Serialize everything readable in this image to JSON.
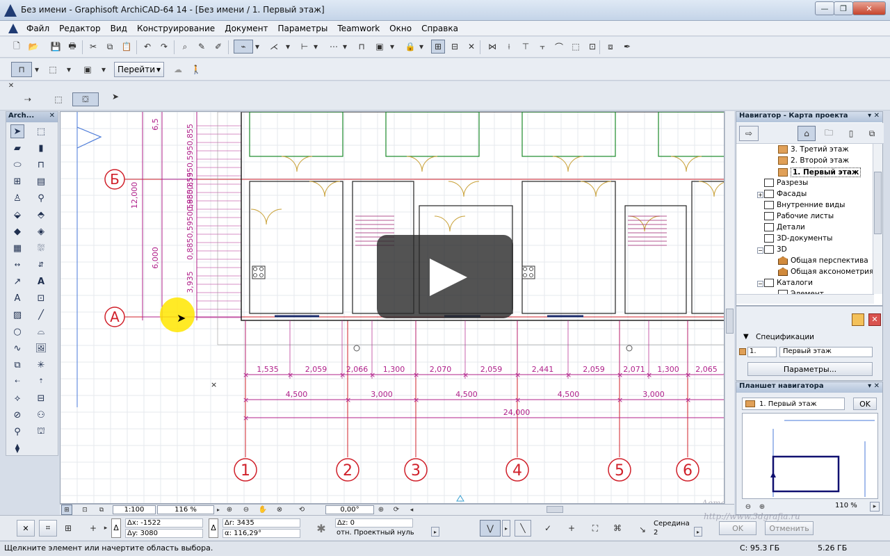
{
  "window": {
    "title": "Без имени - Graphisoft ArchiCAD-64 14 - [Без имени / 1. Первый этаж]",
    "btn_min": "—",
    "btn_max": "❐",
    "btn_close": "✕"
  },
  "menu": [
    "Файл",
    "Редактор",
    "Вид",
    "Конструирование",
    "Документ",
    "Параметры",
    "Teamwork",
    "Окно",
    "Справка"
  ],
  "toolbar2": {
    "goto_label": "Перейти"
  },
  "toolbox": {
    "title": "Arch..."
  },
  "plan": {
    "axis_letters": [
      "Б",
      "А"
    ],
    "axis_numbers": [
      "1",
      "2",
      "3",
      "4",
      "5",
      "6"
    ],
    "dims_row1": [
      "1,535",
      "2,059",
      "2,066",
      "1,300",
      "2,070",
      "2,059",
      "2,441",
      "2,059",
      "2,071",
      "1,300",
      "2,065"
    ],
    "dims_row2": [
      "4,500",
      "3,000",
      "4,500",
      "4,500",
      "3,000"
    ],
    "dim_total": "24,000",
    "dims_vertical": [
      "12,000",
      "6,000",
      "3,935",
      "0,8850,5950,5950,855",
      "0,8850,5950,5950,855",
      "6,5"
    ]
  },
  "canvasbar": {
    "scale": "1:100",
    "zoom": "116 %",
    "angle": "0,00°",
    "zoom_preview": "110 %"
  },
  "navigator": {
    "title": "Навигатор - Карта проекта",
    "items": [
      {
        "label": "3. Третий этаж",
        "type": "story"
      },
      {
        "label": "2. Второй этаж",
        "type": "story"
      },
      {
        "label": "1. Первый этаж",
        "type": "story",
        "current": true
      },
      {
        "label": "Разрезы",
        "type": "folder"
      },
      {
        "label": "Фасады",
        "type": "folder"
      },
      {
        "label": "Внутренние виды",
        "type": "folder"
      },
      {
        "label": "Рабочие листы",
        "type": "folder"
      },
      {
        "label": "Детали",
        "type": "folder"
      },
      {
        "label": "3D-документы",
        "type": "folder"
      },
      {
        "label": "3D",
        "type": "folder"
      },
      {
        "label": "Общая перспектива",
        "type": "view3d"
      },
      {
        "label": "Общая аксонометрия",
        "type": "view3d"
      },
      {
        "label": "Каталоги",
        "type": "folder"
      },
      {
        "label": "Элемент...",
        "type": "folder"
      }
    ]
  },
  "navprops": {
    "section": "Спецификации",
    "num": "1.",
    "name": "Первый этаж",
    "params_btn": "Параметры..."
  },
  "preview": {
    "title": "Планшет навигатора",
    "story": "1. Первый этаж",
    "ok": "OK"
  },
  "infobox": {
    "dx": "Δx: -1522",
    "dy": "Δy: 3080",
    "dr": "Δr: 3435",
    "da": "α: 116,29°",
    "dz": "Δz: 0",
    "ref": "отн. Проектный нуль",
    "mid_label": "Середина",
    "mid_val": "2",
    "ok": "OK",
    "cancel": "Отменить"
  },
  "status": {
    "hint": "Щелкните элемент или начертите область выбора.",
    "disk": "C: 95.3 ГБ",
    "ram": "5.26 ГБ"
  },
  "watermark": {
    "author": "Автор: Сергей Цурсторо",
    "site": "http://www.3dgrafia.ru"
  },
  "colors": {
    "dim": "#b0208a",
    "wall": "#222222",
    "door": "#c9a23a",
    "zone": "#1b8a2a",
    "axis": "#d0202a"
  }
}
